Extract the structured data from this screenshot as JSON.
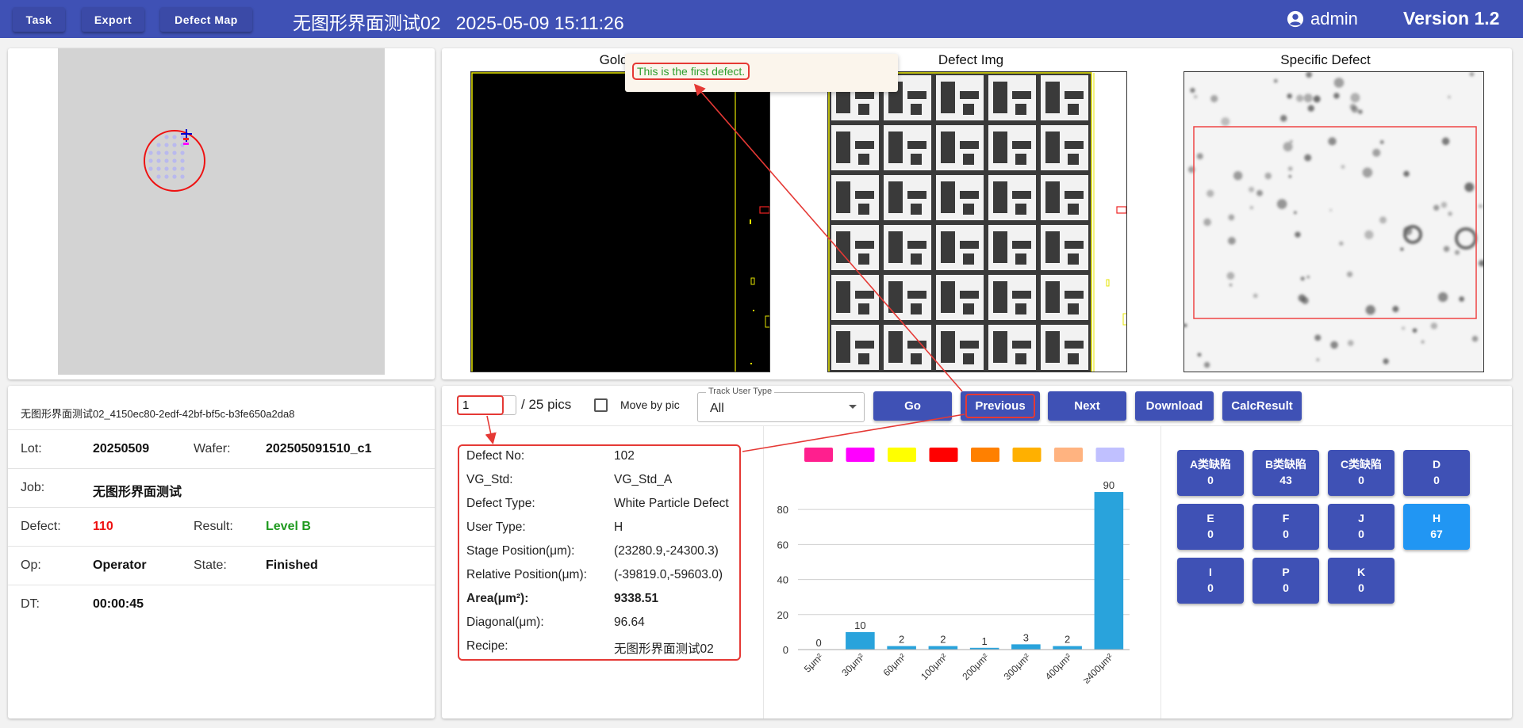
{
  "header": {
    "task_label": "Task",
    "export_label": "Export",
    "defect_map_label": "Defect Map",
    "title": "无图形界面测试02   2025-05-09 15:11:26",
    "user": "admin",
    "version": "Version 1.2",
    "color": "#3f51b5"
  },
  "images": {
    "golden_title": "Golden",
    "defect_title": "Defect Img",
    "specific_title": "Specific Defect"
  },
  "tooltip": {
    "text": "This is the first defect."
  },
  "info": {
    "filename": "无图形界面测试02_4150ec80-2edf-42bf-bf5c-b3fe650a2da8",
    "lot_label": "Lot:",
    "lot": "20250509",
    "wafer_label": "Wafer:",
    "wafer": "202505091510_c1",
    "job_label": "Job:",
    "job": "无图形界面测试",
    "defect_label": "Defect:",
    "defect": "110",
    "result_label": "Result:",
    "result": "Level B",
    "op_label": "Op:",
    "op": "Operator",
    "state_label": "State:",
    "state": "Finished",
    "dt_label": "DT:",
    "dt": "00:00:45"
  },
  "controls": {
    "pic_value": "1",
    "pic_total": "/ 25 pics",
    "move_by_pic": "Move by pic",
    "track_label": "Track User Type",
    "track_value": "All",
    "go": "Go",
    "previous": "Previous",
    "next": "Next",
    "download": "Download",
    "calc": "CalcResult"
  },
  "detail": [
    {
      "label": "Defect No:",
      "value": "102",
      "bold": false
    },
    {
      "label": "VG_Std:",
      "value": "VG_Std_A",
      "bold": false
    },
    {
      "label": "Defect Type:",
      "value": "White Particle Defect",
      "bold": false
    },
    {
      "label": "User Type:",
      "value": "H",
      "bold": false
    },
    {
      "label": "Stage Position(μm):",
      "value": "(23280.9,-24300.3)",
      "bold": false
    },
    {
      "label": "Relative Position(μm):",
      "value": "(-39819.0,-59603.0)",
      "bold": false
    },
    {
      "label": "Area(μm²):",
      "value": "9338.51",
      "bold": true
    },
    {
      "label": "Diagonal(μm):",
      "value": "96.64",
      "bold": false
    },
    {
      "label": "Recipe:",
      "value": "无图形界面测试02",
      "bold": false
    }
  ],
  "legend_colors": [
    "#ff1f8e",
    "#ff00ff",
    "#ffff00",
    "#ff0000",
    "#ff8000",
    "#ffb000",
    "#ffb380",
    "#c0c0ff"
  ],
  "chart_data": {
    "type": "bar",
    "categories": [
      "5μm²",
      "30μm²",
      "60μm²",
      "100μm²",
      "200μm²",
      "300μm²",
      "400μm²",
      "≥400μm²"
    ],
    "values": [
      0,
      10,
      2,
      2,
      1,
      3,
      2,
      90
    ],
    "yticks": [
      0,
      20,
      40,
      60,
      80
    ],
    "ylim": [
      0,
      95
    ],
    "bar_color": "#29a3dc",
    "grid": true
  },
  "user_types": [
    {
      "name": "A类缺陷",
      "count": "0",
      "active": false
    },
    {
      "name": "B类缺陷",
      "count": "43",
      "active": false
    },
    {
      "name": "C类缺陷",
      "count": "0",
      "active": false
    },
    {
      "name": "D",
      "count": "0",
      "active": false
    },
    {
      "name": "E",
      "count": "0",
      "active": false
    },
    {
      "name": "F",
      "count": "0",
      "active": false
    },
    {
      "name": "J",
      "count": "0",
      "active": false
    },
    {
      "name": "H",
      "count": "67",
      "active": true
    },
    {
      "name": "I",
      "count": "0",
      "active": false
    },
    {
      "name": "P",
      "count": "0",
      "active": false
    },
    {
      "name": "K",
      "count": "0",
      "active": false
    }
  ]
}
